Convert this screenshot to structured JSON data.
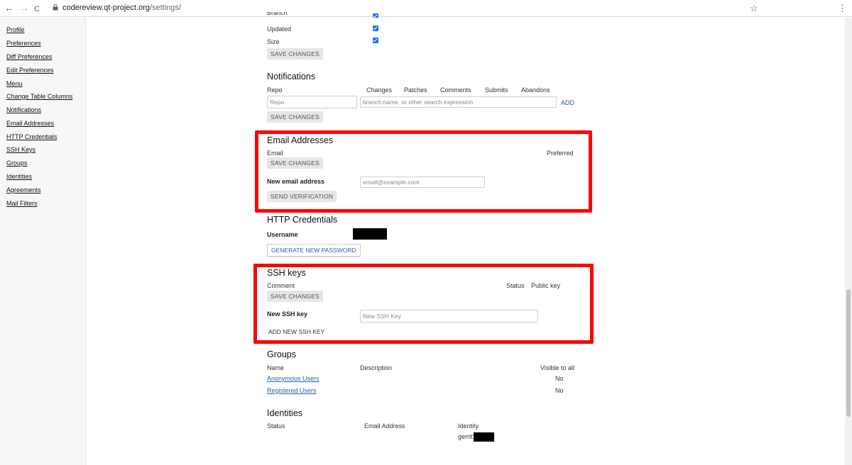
{
  "browser": {
    "back": "←",
    "forward": "→",
    "reload": "C",
    "url_domain": "codereview.qt-project.org",
    "url_path": "/settings/"
  },
  "sidebar": {
    "items": [
      {
        "label": "Profile"
      },
      {
        "label": "Preferences"
      },
      {
        "label": "Diff Preferences"
      },
      {
        "label": "Edit Preferences"
      },
      {
        "label": "Menu"
      },
      {
        "label": "Change Table Columns"
      },
      {
        "label": "Notifications"
      },
      {
        "label": "Email Addresses"
      },
      {
        "label": "HTTP Credentials"
      },
      {
        "label": "SSH Keys"
      },
      {
        "label": "Groups"
      },
      {
        "label": "Identities"
      },
      {
        "label": "Agreements"
      },
      {
        "label": "Mail Filters"
      }
    ]
  },
  "columns": {
    "partial_label": "Branch",
    "rows": [
      {
        "label": "Updated",
        "checked": true
      },
      {
        "label": "Size",
        "checked": true
      }
    ],
    "save_label": "SAVE CHANGES"
  },
  "notifications": {
    "title": "Notifications",
    "headers": [
      "Repo",
      "Changes",
      "Patches",
      "Comments",
      "Submits",
      "Abandons"
    ],
    "repo_placeholder": "Repo",
    "filter_placeholder": "branch:name, or other search expression",
    "add_label": "ADD",
    "save_label": "SAVE CHANGES"
  },
  "email": {
    "title": "Email Addresses",
    "col_email": "Email",
    "col_preferred": "Preferred",
    "save_label": "SAVE CHANGES",
    "new_label": "New email address",
    "new_placeholder": "email@example.com",
    "send_label": "SEND VERIFICATION"
  },
  "http": {
    "title": "HTTP Credentials",
    "username_label": "Username",
    "generate_label": "GENERATE NEW PASSWORD"
  },
  "ssh": {
    "title": "SSH keys",
    "col_comment": "Comment",
    "col_status": "Status",
    "col_public_key": "Public key",
    "save_label": "SAVE CHANGES",
    "new_label": "New SSH key",
    "new_placeholder": "New SSH Key",
    "add_label": "ADD NEW SSH KEY"
  },
  "groups": {
    "title": "Groups",
    "col_name": "Name",
    "col_description": "Description",
    "col_visible": "Visible to all",
    "rows": [
      {
        "name": "Anonymous Users",
        "visible": "No"
      },
      {
        "name": "Registered Users",
        "visible": "No"
      }
    ]
  },
  "identities": {
    "title": "Identities",
    "col_status": "Status",
    "col_email": "Email Address",
    "col_identity": "Identity",
    "identity_prefix": "gerrit:"
  },
  "colors": {
    "highlight": "#ff0000",
    "link": "#2962a5",
    "checkbox": "#1a73e8"
  }
}
